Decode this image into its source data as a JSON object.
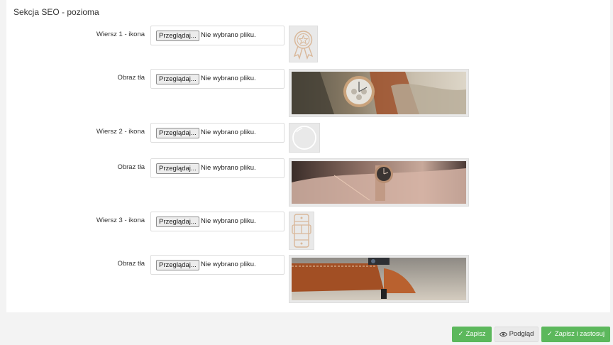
{
  "section": {
    "title": "Sekcja SEO - pozioma"
  },
  "rows": [
    {
      "label": "Wiersz 1 - ikona",
      "browse": "Przeglądaj...",
      "status": "Nie wybrano pliku.",
      "preview": "ribbon-award-icon"
    },
    {
      "label": "Obraz tła",
      "browse": "Przeglądaj...",
      "status": "Nie wybrano pliku.",
      "preview": "watch-photo"
    },
    {
      "label": "Wiersz 2 - ikona",
      "browse": "Przeglądaj...",
      "status": "Nie wybrano pliku.",
      "preview": "circle-icon"
    },
    {
      "label": "Obraz tła",
      "browse": "Przeglądaj...",
      "status": "Nie wybrano pliku.",
      "preview": "wrist-watch-photo"
    },
    {
      "label": "Wiersz 3 - ikona",
      "browse": "Przeglądaj...",
      "status": "Nie wybrano pliku.",
      "preview": "watch-strap-icon"
    },
    {
      "label": "Obraz tła",
      "browse": "Przeglądaj...",
      "status": "Nie wybrano pliku.",
      "preview": "leather-strap-photo"
    }
  ],
  "footer": {
    "save": "Zapisz",
    "preview": "Podgląd",
    "save_apply": "Zapisz i zastosuj"
  },
  "colors": {
    "green": "#5cb85c",
    "icon_tan": "#d9b89a"
  }
}
